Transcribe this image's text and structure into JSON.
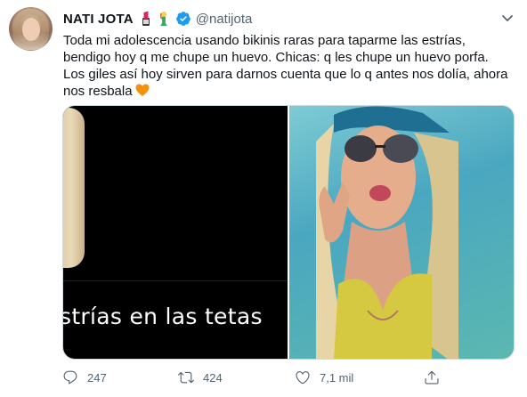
{
  "user": {
    "display_name": "NATI JOTA",
    "handle": "@natijota",
    "verified": true,
    "name_emojis": [
      "lipstick-emoji",
      "mermaid-emoji"
    ]
  },
  "tweet": {
    "text": "Toda mi adolescencia usando bikinis raras para taparme las estrías,\nbendigo hoy q me chupe un huevo. Chicas: q les chupe un huevo porfa.\nLos giles así hoy sirven para darnos cuenta que lo q antes nos dolía, ahora\nnos resbala",
    "trailing_emoji": "orange-heart-emoji"
  },
  "media": {
    "left_caption": "strías en las tetas",
    "right_description_icon": "photo-woman-sunglasses"
  },
  "actions": {
    "replies": "247",
    "retweets": "424",
    "likes": "7,1 mil",
    "share": ""
  },
  "colors": {
    "verified_blue": "#1d9bf0",
    "secondary_text": "#536471",
    "heart_orange": "#f4900c"
  }
}
